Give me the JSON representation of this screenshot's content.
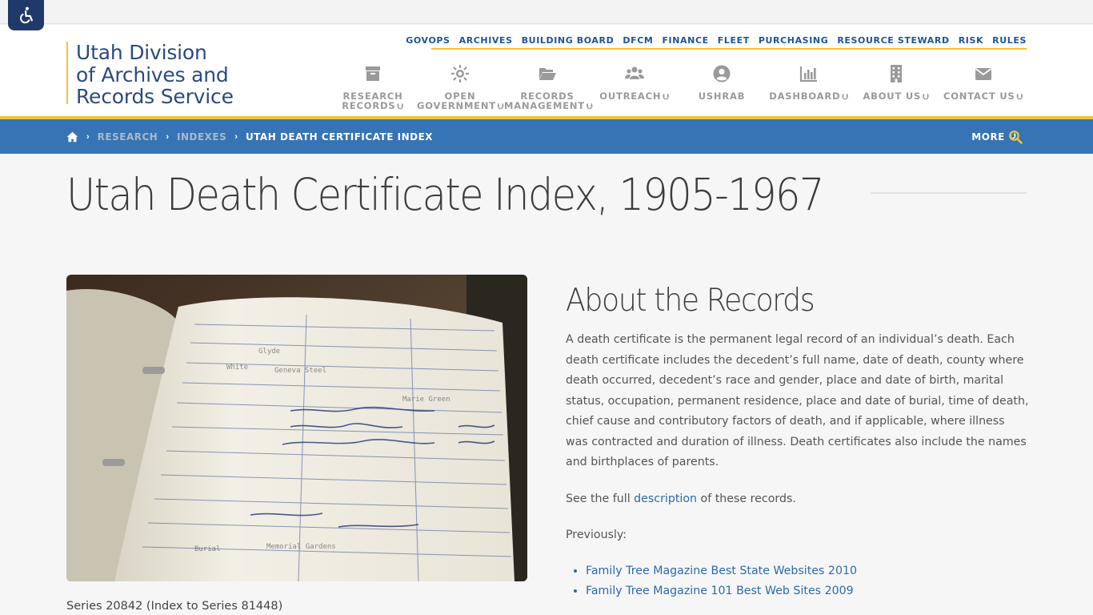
{
  "accessibility": {
    "icon": "wheelchair-icon"
  },
  "site": {
    "logo_lines": [
      "Utah Division",
      "of Archives and",
      "Records Service"
    ]
  },
  "utility_nav": [
    "GOVOPS",
    "ARCHIVES",
    "BUILDING BOARD",
    "DFCM",
    "FINANCE",
    "FLEET",
    "PURCHASING",
    "RESOURCE STEWARD",
    "RISK",
    "RULES"
  ],
  "main_nav": [
    {
      "line1": "RESEARCH",
      "line2": "RECORDS",
      "icon": "archive-box-icon",
      "dropdown": true
    },
    {
      "line1": "OPEN",
      "line2": "GOVERNMENT",
      "icon": "sun-icon",
      "dropdown": true
    },
    {
      "line1": "RECORDS",
      "line2": "MANAGEMENT",
      "icon": "folder-open-icon",
      "dropdown": true
    },
    {
      "line1": "OUTREACH",
      "line2": "",
      "icon": "users-icon",
      "dropdown": true
    },
    {
      "line1": "USHRAB",
      "line2": "",
      "icon": "user-circle-icon",
      "dropdown": false
    },
    {
      "line1": "DASHBOARD",
      "line2": "",
      "icon": "bar-chart-icon",
      "dropdown": true
    },
    {
      "line1": "ABOUT US",
      "line2": "",
      "icon": "building-icon",
      "dropdown": true
    },
    {
      "line1": "CONTACT US",
      "line2": "",
      "icon": "envelope-icon",
      "dropdown": true
    }
  ],
  "breadcrumb": {
    "home_icon": "home-icon",
    "items": [
      "RESEARCH",
      "INDEXES",
      "UTAH DEATH CERTIFICATE INDEX"
    ],
    "more_label": "MORE",
    "search_icon": "search-icon"
  },
  "page": {
    "title": "Utah Death Certificate Index, 1905-1967",
    "caption": "Series 20842 (Index to Series 81448)",
    "about_heading": "About the Records",
    "about_text": "A death certificate is the permanent legal record of an individual’s death. Each death certificate includes the decedent’s full name, date of death, county where death occurred, decedent’s race and gender, place and date of birth, marital status, occupation, permanent residence, place and date of burial, time of death, chief cause and contributory factors of death, and if applicable, where illness was contracted and duration of illness. Death certificates also include the names and birthplaces of parents.",
    "see_prefix": "See the full ",
    "see_link": "description",
    "see_suffix": " of these records.",
    "previously": "Previously:",
    "awards": [
      "Family Tree Magazine Best State Websites 2010",
      "Family Tree Magazine 101 Best Web Sites 2009"
    ]
  },
  "colors": {
    "brand_blue": "#2c4a80",
    "bar_blue": "#3674b5",
    "accent_yellow": "#f3c332",
    "link_blue": "#2d6aa8"
  }
}
